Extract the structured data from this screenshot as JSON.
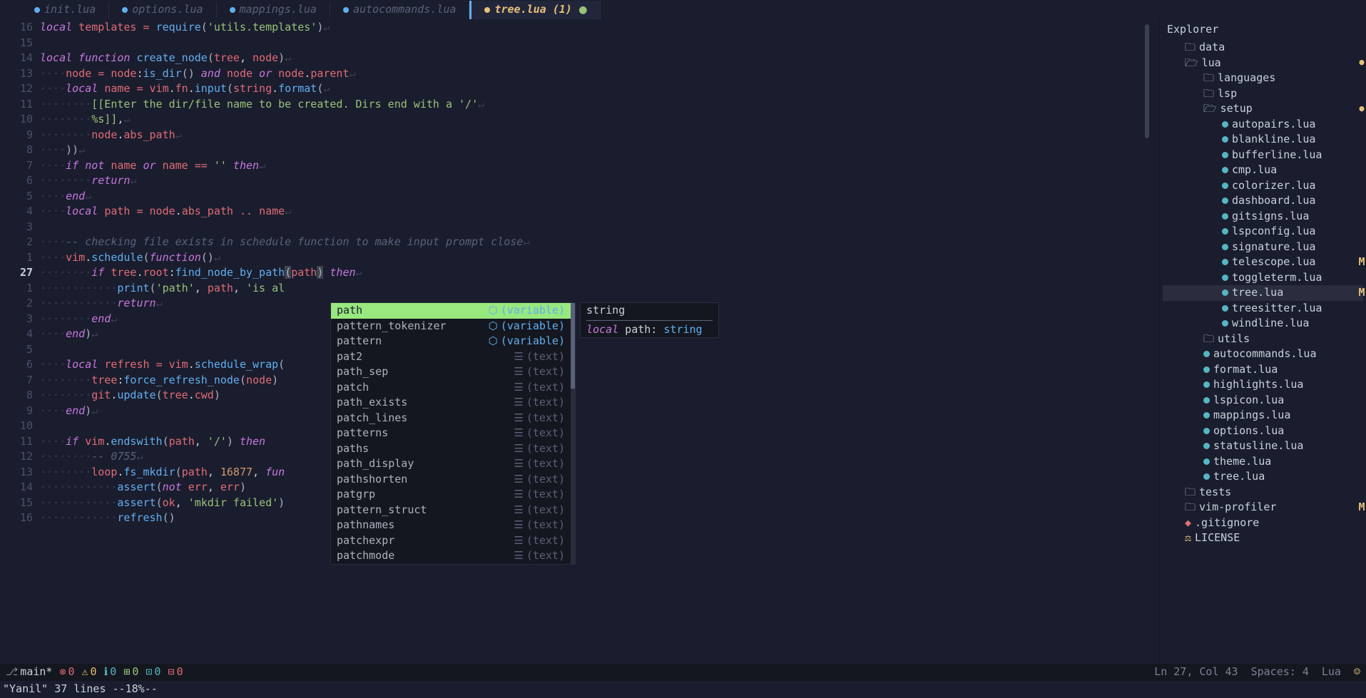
{
  "tabs": [
    {
      "name": "init.lua",
      "active": false
    },
    {
      "name": "options.lua",
      "active": false
    },
    {
      "name": "mappings.lua",
      "active": false
    },
    {
      "name": "autocommands.lua",
      "active": false
    },
    {
      "name": "tree.lua (1)",
      "active": true,
      "modified": true
    }
  ],
  "gutter": [
    "16",
    "15",
    "14",
    "13",
    "12",
    "11",
    "10",
    "9",
    "8",
    "7",
    "6",
    "5",
    "4",
    "3",
    "2",
    "1",
    "27",
    "1",
    "2",
    "3",
    "4",
    "5",
    "6",
    "7",
    "8",
    "9",
    "10",
    "11",
    "12",
    "13",
    "14",
    "15",
    "16"
  ],
  "code": {
    "l0": {
      "kw": "local",
      "var": " templates ",
      "op": "= ",
      "fn": "require",
      "p1": "(",
      "str": "'utils.templates'",
      "p2": ")",
      "w": "↵"
    },
    "l2": {
      "kw": "local function ",
      "fn": "create_node",
      "p1": "(",
      "a1": "tree",
      "c": ", ",
      "a2": "node",
      "p2": ")",
      "w": "↵"
    },
    "l3": {
      "in": "    ",
      "v1": "node ",
      "op": "= ",
      "v2": "node",
      "c1": ":",
      "fn": "is_dir",
      "p": "()",
      "kw1": " and ",
      "v3": "node",
      "kw2": " or ",
      "v4": "node",
      "d": ".",
      "v5": "parent",
      "w": "↵"
    },
    "l4": {
      "in": "    ",
      "kw": "local ",
      "v": "name ",
      "op": "= ",
      "o1": "vim",
      "d1": ".",
      "o2": "fn",
      "d2": ".",
      "fn": "input",
      "p1": "(",
      "o3": "string",
      "d3": ".",
      "fn2": "format",
      "p2": "(",
      "w": "↵"
    },
    "l5": {
      "in": "        ",
      "str": "[[Enter the dir/file name to be created. Dirs end with a '/'",
      "w": "↵"
    },
    "l6": {
      "in": "        ",
      "str": "%s]]",
      "c": ",",
      "w": "↵"
    },
    "l7": {
      "in": "        ",
      "v1": "node",
      "d": ".",
      "v2": "abs_path",
      "w": "↵"
    },
    "l8": {
      "in": "    ",
      "p": "))",
      "w": "↵"
    },
    "l9": {
      "in": "    ",
      "kw1": "if not ",
      "v": "name",
      "kw2": " or ",
      "v2": "name ",
      "op": "== ",
      "str": "''",
      "kw3": " then",
      "w": "↵"
    },
    "l10": {
      "in": "        ",
      "kw": "return",
      "w": "↵"
    },
    "l11": {
      "in": "    ",
      "kw": "end",
      "w": "↵"
    },
    "l12": {
      "in": "    ",
      "kw": "local ",
      "v": "path ",
      "op": "= ",
      "v2": "node",
      "d": ".",
      "v3": "abs_path ",
      "op2": ".. ",
      "v4": "name",
      "w": "↵"
    },
    "l14": {
      "in": "    ",
      "cmt": "-- checking file exists in schedule function to make input prompt close",
      "w": "↵"
    },
    "l15": {
      "in": "    ",
      "v1": "vim",
      "d": ".",
      "fn": "schedule",
      "p1": "(",
      "kw": "function",
      "p2": "()",
      "w": "↵"
    },
    "l16": {
      "in": "        ",
      "kw1": "if ",
      "v1": "tree",
      "d1": ".",
      "v2": "root",
      "c": ":",
      "fn": "find_node_by_path",
      "p1": "(",
      "v3": "path",
      "p2": ")",
      "kw2": " then",
      "w": "↵"
    },
    "l17": {
      "in": "            ",
      "fn": "print",
      "p1": "(",
      "s1": "'path'",
      "c1": ", ",
      "v": "path",
      "c2": ", ",
      "s2": "'is al"
    },
    "l18": {
      "in": "            ",
      "kw": "return",
      "w": "↵"
    },
    "l19": {
      "in": "        ",
      "kw": "end",
      "w": "↵"
    },
    "l20": {
      "in": "    ",
      "kw": "end",
      "p": ")",
      "w": "↵"
    },
    "l22": {
      "in": "    ",
      "kw": "local ",
      "v": "refresh ",
      "op": "= ",
      "v2": "vim",
      "d": ".",
      "fn": "schedule_wrap",
      "p": "("
    },
    "l23": {
      "in": "        ",
      "v1": "tree",
      "c": ":",
      "fn": "force_refresh_node",
      "p1": "(",
      "v2": "node",
      "p2": ")"
    },
    "l24": {
      "in": "        ",
      "v1": "git",
      "d": ".",
      "fn": "update",
      "p1": "(",
      "v2": "tree",
      "d2": ".",
      "v3": "cwd",
      "p2": ")"
    },
    "l25": {
      "in": "    ",
      "kw": "end",
      "p": ")",
      "w": "↵"
    },
    "l27": {
      "in": "    ",
      "kw1": "if ",
      "v1": "vim",
      "d": ".",
      "fn": "endswith",
      "p1": "(",
      "v2": "path",
      "c": ", ",
      "str": "'/'",
      "p2": ")",
      "kw2": " then"
    },
    "l28": {
      "in": "        ",
      "cmt": "-- 0755",
      "w": "↵"
    },
    "l29": {
      "in": "        ",
      "v1": "loop",
      "d1": ".",
      "fn": "fs_mkdir",
      "p1": "(",
      "v2": "path",
      "c1": ", ",
      "n": "16877",
      "c2": ", ",
      "kw": "fun"
    },
    "l30": {
      "in": "            ",
      "fn": "assert",
      "p1": "(",
      "kw": "not ",
      "v1": "err",
      "c": ", ",
      "v2": "err",
      "p2": ")"
    },
    "l31": {
      "in": "            ",
      "fn": "assert",
      "p1": "(",
      "v1": "ok",
      "c": ", ",
      "str": "'mkdir failed'",
      "p2": ")"
    },
    "l32": {
      "in": "            ",
      "fn": "refresh",
      "p": "()"
    }
  },
  "completion": {
    "items": [
      {
        "name": "path",
        "kind": "(variable)",
        "icon": "v",
        "sel": true
      },
      {
        "name": "pattern_tokenizer",
        "kind": "(variable)",
        "icon": "v"
      },
      {
        "name": "pattern",
        "kind": "(variable)",
        "icon": "v"
      },
      {
        "name": "pat2",
        "kind": "(text)",
        "icon": "t"
      },
      {
        "name": "path_sep",
        "kind": "(text)",
        "icon": "t"
      },
      {
        "name": "patch",
        "kind": "(text)",
        "icon": "t"
      },
      {
        "name": "path_exists",
        "kind": "(text)",
        "icon": "t"
      },
      {
        "name": "patch_lines",
        "kind": "(text)",
        "icon": "t"
      },
      {
        "name": "patterns",
        "kind": "(text)",
        "icon": "t"
      },
      {
        "name": "paths",
        "kind": "(text)",
        "icon": "t"
      },
      {
        "name": "path_display",
        "kind": "(text)",
        "icon": "t"
      },
      {
        "name": "pathshorten",
        "kind": "(text)",
        "icon": "t"
      },
      {
        "name": "patgrp",
        "kind": "(text)",
        "icon": "t"
      },
      {
        "name": "pattern_struct",
        "kind": "(text)",
        "icon": "t"
      },
      {
        "name": "pathnames",
        "kind": "(text)",
        "icon": "t"
      },
      {
        "name": "patchexpr",
        "kind": "(text)",
        "icon": "t"
      },
      {
        "name": "patchmode",
        "kind": "(text)",
        "icon": "t"
      }
    ],
    "doc": {
      "type": "string",
      "sig_kw": "local",
      "sig_var": " path: ",
      "sig_ty": "string"
    }
  },
  "explorer": {
    "title": "Explorer",
    "tree": [
      {
        "depth": 1,
        "type": "folder",
        "name": "data",
        "open": false
      },
      {
        "depth": 1,
        "type": "folder",
        "name": "lua",
        "open": true,
        "git": "dot"
      },
      {
        "depth": 2,
        "type": "folder",
        "name": "languages",
        "open": false
      },
      {
        "depth": 2,
        "type": "folder",
        "name": "lsp",
        "open": false
      },
      {
        "depth": 2,
        "type": "folder",
        "name": "setup",
        "open": true,
        "git": "dot"
      },
      {
        "depth": 3,
        "type": "lua",
        "name": "autopairs.lua"
      },
      {
        "depth": 3,
        "type": "lua",
        "name": "blankline.lua"
      },
      {
        "depth": 3,
        "type": "lua",
        "name": "bufferline.lua"
      },
      {
        "depth": 3,
        "type": "lua",
        "name": "cmp.lua"
      },
      {
        "depth": 3,
        "type": "lua",
        "name": "colorizer.lua"
      },
      {
        "depth": 3,
        "type": "lua",
        "name": "dashboard.lua"
      },
      {
        "depth": 3,
        "type": "lua",
        "name": "gitsigns.lua"
      },
      {
        "depth": 3,
        "type": "lua",
        "name": "lspconfig.lua"
      },
      {
        "depth": 3,
        "type": "lua",
        "name": "signature.lua"
      },
      {
        "depth": 3,
        "type": "lua",
        "name": "telescope.lua",
        "git": "M"
      },
      {
        "depth": 3,
        "type": "lua",
        "name": "toggleterm.lua"
      },
      {
        "depth": 3,
        "type": "lua",
        "name": "tree.lua",
        "active": true,
        "git": "M"
      },
      {
        "depth": 3,
        "type": "lua",
        "name": "treesitter.lua"
      },
      {
        "depth": 3,
        "type": "lua",
        "name": "windline.lua"
      },
      {
        "depth": 2,
        "type": "folder",
        "name": "utils",
        "open": false
      },
      {
        "depth": 2,
        "type": "lua",
        "name": "autocommands.lua"
      },
      {
        "depth": 2,
        "type": "lua",
        "name": "format.lua"
      },
      {
        "depth": 2,
        "type": "lua",
        "name": "highlights.lua"
      },
      {
        "depth": 2,
        "type": "lua",
        "name": "lspicon.lua"
      },
      {
        "depth": 2,
        "type": "lua",
        "name": "mappings.lua"
      },
      {
        "depth": 2,
        "type": "lua",
        "name": "options.lua"
      },
      {
        "depth": 2,
        "type": "lua",
        "name": "statusline.lua"
      },
      {
        "depth": 2,
        "type": "lua",
        "name": "theme.lua"
      },
      {
        "depth": 2,
        "type": "lua",
        "name": "tree.lua"
      },
      {
        "depth": 1,
        "type": "folder",
        "name": "tests",
        "open": false
      },
      {
        "depth": 1,
        "type": "folder",
        "name": "vim-profiler",
        "open": false,
        "git": "M"
      },
      {
        "depth": 1,
        "type": "git",
        "name": ".gitignore"
      },
      {
        "depth": 1,
        "type": "license",
        "name": "LICENSE"
      }
    ]
  },
  "status": {
    "branch": "main*",
    "err": "0",
    "warn": "0",
    "info": "0",
    "add": "0",
    "mod": "0",
    "del": "0",
    "pos": "Ln 27, Col 43",
    "spaces": "Spaces: 4",
    "lang": "Lua"
  },
  "cmdline": "\"Yanil\"  37 lines --18%--"
}
